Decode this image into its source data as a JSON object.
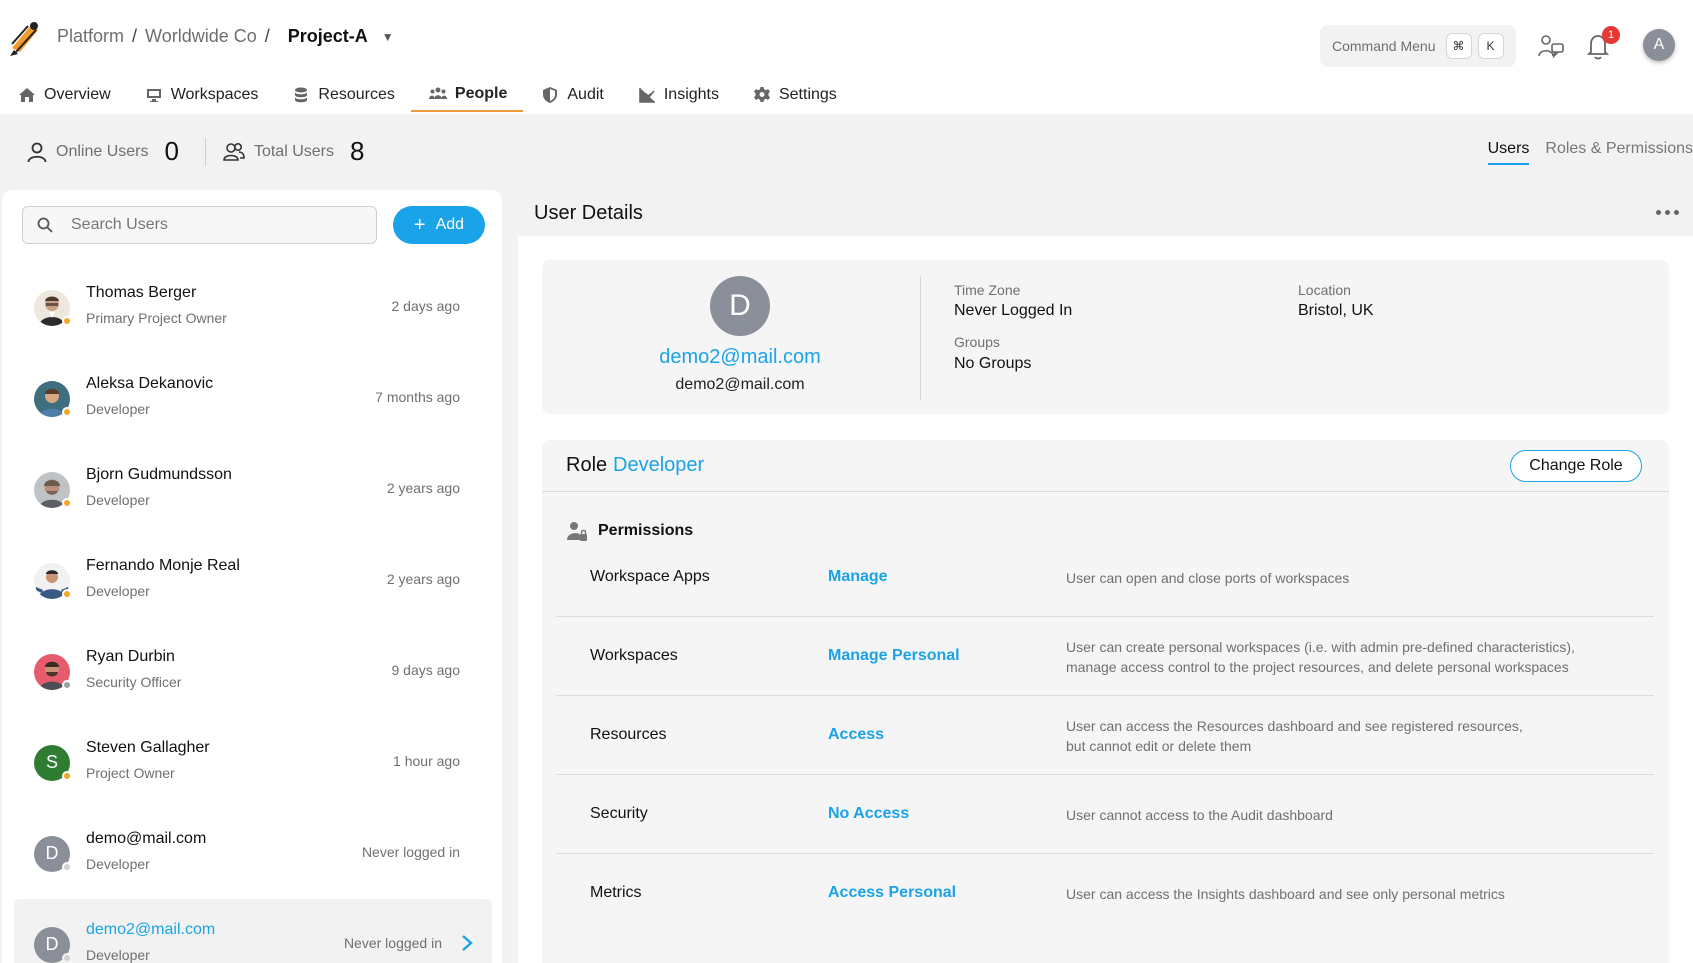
{
  "header": {
    "breadcrumb": [
      "Platform",
      "Worldwide Co",
      "Project-A"
    ],
    "command_menu": {
      "label": "Command Menu",
      "key1": "⌘",
      "key2": "K"
    },
    "notification_count": "1",
    "user_initial": "A"
  },
  "tabs": [
    {
      "label": "Overview",
      "icon": "home-icon"
    },
    {
      "label": "Workspaces",
      "icon": "monitor-icon"
    },
    {
      "label": "Resources",
      "icon": "database-icon"
    },
    {
      "label": "People",
      "icon": "people-icon",
      "active": true
    },
    {
      "label": "Audit",
      "icon": "shield-icon"
    },
    {
      "label": "Insights",
      "icon": "chart-line-icon"
    },
    {
      "label": "Settings",
      "icon": "gear-icon"
    }
  ],
  "stats": {
    "online_label": "Online Users",
    "online_value": "0",
    "total_label": "Total Users",
    "total_value": "8"
  },
  "subtabs": [
    {
      "label": "Users",
      "active": true
    },
    {
      "label": "Roles & Permissions"
    }
  ],
  "users_panel": {
    "search_placeholder": "Search Users",
    "add_label": "Add",
    "users": [
      {
        "name": "Thomas Berger",
        "role": "Primary Project Owner",
        "last": "2 days ago"
      },
      {
        "name": "Aleksa Dekanovic",
        "role": "Developer",
        "last": "7 months ago"
      },
      {
        "name": "Bjorn Gudmundsson",
        "role": "Developer",
        "last": "2 years ago"
      },
      {
        "name": "Fernando Monje Real",
        "role": "Developer",
        "last": "2 years ago"
      },
      {
        "name": "Ryan Durbin",
        "role": "Security Officer",
        "last": "9 days ago"
      },
      {
        "name": "Steven Gallagher",
        "role": "Project Owner",
        "last": "1 hour ago",
        "initial": "S"
      },
      {
        "name": "demo@mail.com",
        "role": "Developer",
        "last": "Never logged in",
        "initial": "D"
      },
      {
        "name": "demo2@mail.com",
        "role": "Developer",
        "last": "Never logged in",
        "initial": "D",
        "selected": true
      }
    ]
  },
  "details": {
    "title": "User Details",
    "initial": "D",
    "email_primary": "demo2@mail.com",
    "email_secondary": "demo2@mail.com",
    "timezone_label": "Time Zone",
    "timezone_value": "Never Logged In",
    "location_label": "Location",
    "location_value": "Bristol, UK",
    "groups_label": "Groups",
    "groups_value": "No Groups",
    "role_label": "Role",
    "role_value": "Developer",
    "change_role_label": "Change Role",
    "permissions_title": "Permissions",
    "permissions": [
      {
        "name": "Workspace Apps",
        "level": "Manage",
        "desc": "User can open and close ports of workspaces"
      },
      {
        "name": "Workspaces",
        "level": "Manage Personal",
        "desc": "User can create personal workspaces (i.e. with admin pre-defined characteristics), manage access control to the project resources, and delete personal workspaces"
      },
      {
        "name": "Resources",
        "level": "Access",
        "desc": "User can access the Resources dashboard and see registered resources, but cannot edit or delete them"
      },
      {
        "name": "Security",
        "level": "No Access",
        "desc": "User cannot access to the Audit dashboard"
      },
      {
        "name": "Metrics",
        "level": "Access Personal",
        "desc": "User can access the Insights dashboard and see only personal metrics"
      }
    ]
  },
  "colors": {
    "accent": "#1aa3e8",
    "tab_underline": "#f09a3e",
    "status_away": "#f5a623",
    "notification": "#e53935"
  }
}
